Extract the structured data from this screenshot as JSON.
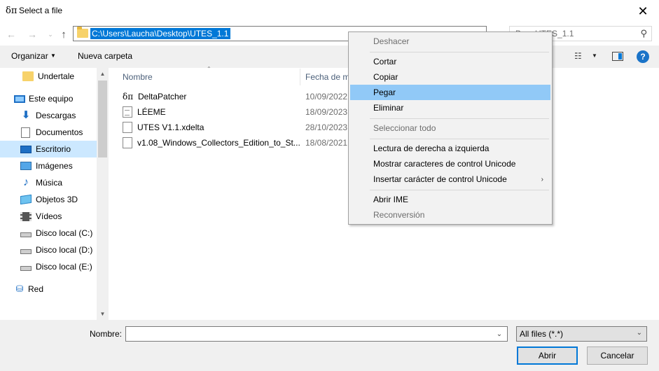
{
  "window": {
    "title": "Select a file",
    "app_glyph": "δπ",
    "close_glyph": "✕"
  },
  "nav": {
    "back_icon": "←",
    "forward_icon": "→",
    "recent_icon": "⌄",
    "up_icon": "↑",
    "address": "C:\\Users\\Laucha\\Desktop\\UTES_1.1",
    "address_dropdown_icon": "⌄",
    "search_placeholder": "Buscar en UTES_1.1",
    "search_visible_text": "B     en UTES_1.1",
    "search_icon": "⚲"
  },
  "toolbar": {
    "organize_label": "Organizar",
    "organize_arrow": "▼",
    "new_folder_label": "Nueva carpeta",
    "view_icon": "☷",
    "view_arrow": "▼",
    "help_label": "?"
  },
  "sidebar": {
    "items": [
      {
        "label": "Undertale",
        "icon": "folder-icon"
      },
      {
        "label": "Este equipo",
        "icon": "computer-icon"
      },
      {
        "label": "Descargas",
        "icon": "download-icon"
      },
      {
        "label": "Documentos",
        "icon": "documents-icon"
      },
      {
        "label": "Escritorio",
        "icon": "desktop-icon",
        "selected": true
      },
      {
        "label": "Imágenes",
        "icon": "pictures-icon"
      },
      {
        "label": "Música",
        "icon": "music-icon"
      },
      {
        "label": "Objetos 3D",
        "icon": "objects-3d-icon"
      },
      {
        "label": "Vídeos",
        "icon": "videos-icon"
      },
      {
        "label": "Disco local (C:)",
        "icon": "drive-icon"
      },
      {
        "label": "Disco local (D:)",
        "icon": "drive-icon"
      },
      {
        "label": "Disco local (E:)",
        "icon": "drive-icon"
      },
      {
        "label": "Red",
        "icon": "network-icon"
      }
    ],
    "music_glyph": "♪",
    "download_glyph": "⬇",
    "network_glyph": "⛁",
    "scroll_up": "▲",
    "scroll_down": "▼"
  },
  "list": {
    "sort_arrow": "⌃",
    "columns": {
      "name": "Nombre",
      "date": "Fecha de m"
    },
    "files": [
      {
        "name": "DeltaPatcher",
        "date": "10/09/2022",
        "icon": "app-icon"
      },
      {
        "name": "LÉEME",
        "date": "18/09/2023",
        "icon": "text-file-icon"
      },
      {
        "name": "UTES V1.1.xdelta",
        "date": "28/10/2023",
        "icon": "blank-file-icon"
      },
      {
        "name": "v1.08_Windows_Collectors_Edition_to_St...",
        "date": "18/08/2021",
        "icon": "blank-file-icon"
      }
    ]
  },
  "bottom": {
    "name_label": "Nombre:",
    "name_value": "",
    "name_dropdown_icon": "⌄",
    "filter_value": "All files (*.*)",
    "filter_arrow": "⌄",
    "open_label": "Abrir",
    "cancel_label": "Cancelar"
  },
  "context_menu": {
    "items": [
      {
        "label": "Deshacer",
        "disabled": true
      },
      {
        "label": "Cortar"
      },
      {
        "label": "Copiar"
      },
      {
        "label": "Pegar",
        "highlight": true
      },
      {
        "label": "Eliminar"
      },
      {
        "label": "Seleccionar todo",
        "disabled": true
      },
      {
        "label": "Lectura de derecha a izquierda"
      },
      {
        "label": "Mostrar caracteres de control Unicode"
      },
      {
        "label": "Insertar carácter de control Unicode",
        "submenu": true
      },
      {
        "label": "Abrir IME"
      },
      {
        "label": "Reconversión",
        "disabled": true
      }
    ],
    "submenu_arrow": "›"
  },
  "colors": {
    "accent": "#0078d7",
    "selected_bg": "#cce8ff",
    "menu_highlight": "#91c9f7",
    "folder": "#f7d26a"
  }
}
